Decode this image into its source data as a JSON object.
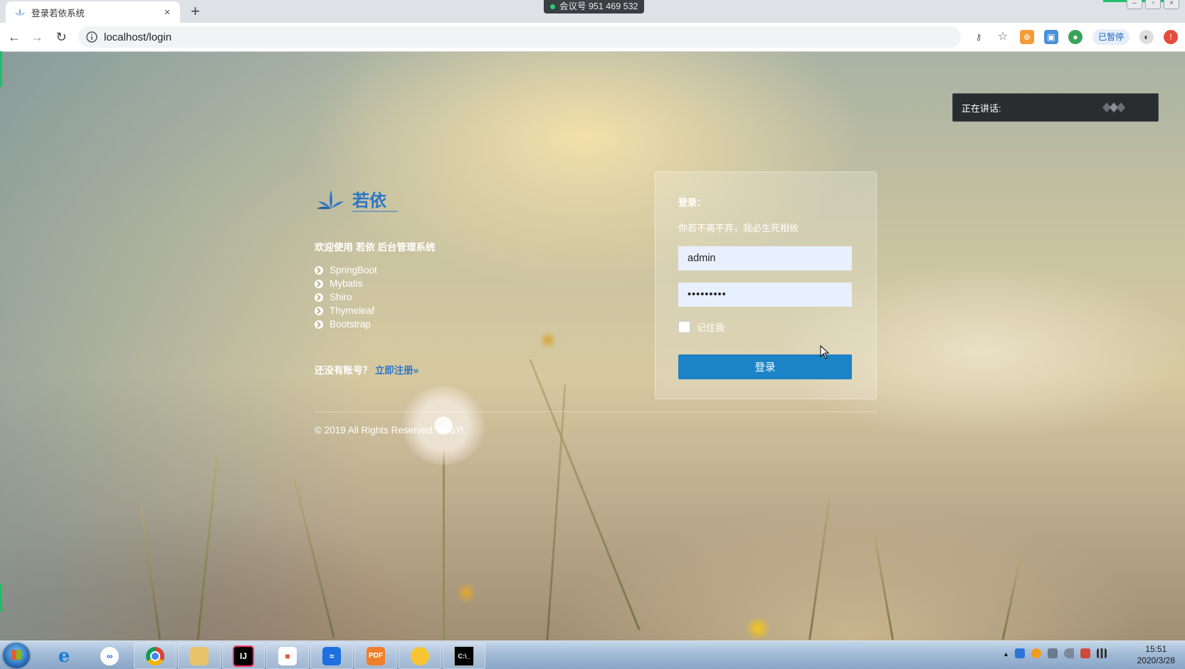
{
  "browser": {
    "tab_title": "登录若依系统",
    "tab_close": "×",
    "new_tab": "+",
    "meeting_id": "会议号 951 469 532",
    "url": "localhost/login",
    "paused_label": "已暂停"
  },
  "brand": {
    "name": "若依",
    "color": "#2c76c8"
  },
  "intro": {
    "welcome": "欢迎使用 若依 后台管理系统",
    "tech": [
      "SpringBoot",
      "Mybatis",
      "Shiro",
      "Thymeleaf",
      "Bootstrap"
    ],
    "register_prompt": "还没有账号？",
    "register_link": "立即注册»",
    "copyright": "© 2019 All Rights Reserved. RuoYi"
  },
  "login": {
    "title": "登录：",
    "subtitle": "你若不离不弃，我必生死相依",
    "username_value": "admin",
    "password_value": "•••••••••",
    "remember_label": "记住我",
    "submit_label": "登录",
    "accent": "#1c84c6"
  },
  "overlay": {
    "speaking_label": "正在讲话:"
  },
  "taskbar": {
    "time": "15:51",
    "date": "2020/3/28"
  }
}
